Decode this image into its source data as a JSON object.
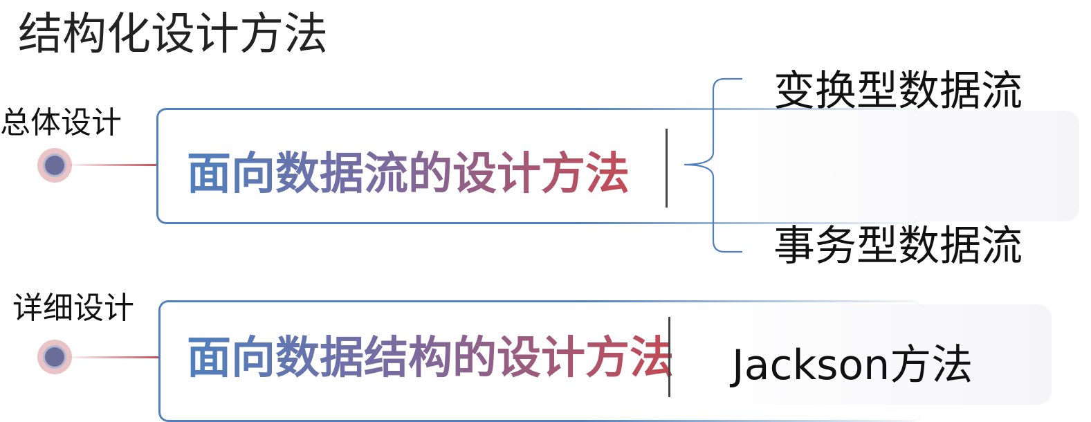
{
  "title": "结构化设计方法",
  "sections": [
    {
      "label": "总体设计",
      "method": "面向数据流的设计方法",
      "branches": [
        "变换型数据流",
        "事务型数据流"
      ]
    },
    {
      "label": "详细设计",
      "method": "面向数据结构的设计方法",
      "branches": [
        "Jackson方法"
      ]
    }
  ],
  "colors": {
    "box_border": "#4f7fbe",
    "gradient_start": "#4f7fbe",
    "gradient_end": "#c44a54",
    "dot_outer": "#e9c3c6",
    "dot_inner": "#6c6e9a",
    "brace": "#4f7fbe"
  }
}
